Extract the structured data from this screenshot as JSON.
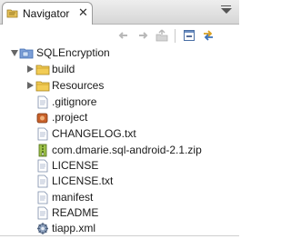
{
  "view": {
    "tab_label": "Navigator",
    "tab_icon": "navigator-folder-icon",
    "close_glyph": "✕",
    "menu_icon": "view-menu-icon"
  },
  "toolbar": {
    "items": [
      "back-arrow-icon",
      "forward-arrow-icon",
      "up-folder-icon",
      "collapse-all-icon",
      "link-with-editor-icon"
    ]
  },
  "tree": {
    "root": {
      "label": "SQLEncryption",
      "icon": "project-folder-icon",
      "expanded": true
    },
    "items": [
      {
        "label": "build",
        "icon": "folder-icon",
        "kind": "folder",
        "expanded": false
      },
      {
        "label": "Resources",
        "icon": "folder-icon",
        "kind": "folder",
        "expanded": false
      },
      {
        "label": ".gitignore",
        "icon": "text-file-icon",
        "kind": "file"
      },
      {
        "label": ".project",
        "icon": "project-file-icon",
        "kind": "file"
      },
      {
        "label": "CHANGELOG.txt",
        "icon": "text-file-icon",
        "kind": "file"
      },
      {
        "label": "com.dmarie.sql-android-2.1.zip",
        "icon": "zip-file-icon",
        "kind": "file"
      },
      {
        "label": "LICENSE",
        "icon": "text-file-icon",
        "kind": "file"
      },
      {
        "label": "LICENSE.txt",
        "icon": "text-file-icon",
        "kind": "file"
      },
      {
        "label": "manifest",
        "icon": "text-file-icon",
        "kind": "file"
      },
      {
        "label": "README",
        "icon": "text-file-icon",
        "kind": "file"
      },
      {
        "label": "tiapp.xml",
        "icon": "xml-config-file-icon",
        "kind": "file"
      }
    ]
  }
}
